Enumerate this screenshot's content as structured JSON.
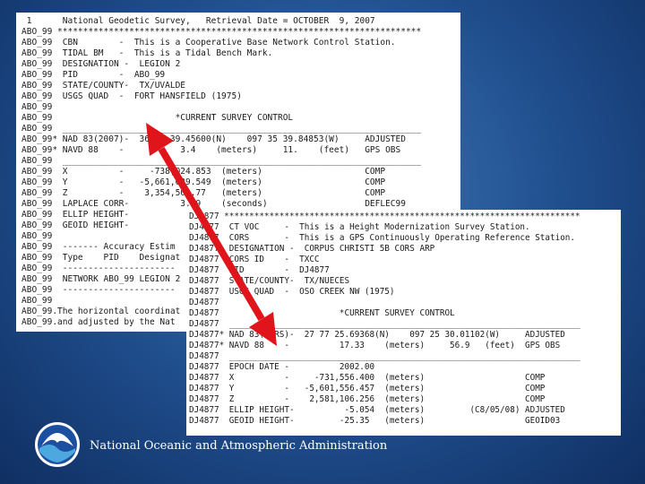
{
  "colors": {
    "background": "#2a5b9c",
    "arrow": "#e0141b",
    "sheet": "#ffffff"
  },
  "sheet1_lines": [
    " 1      National Geodetic Survey,   Retrieval Date = OCTOBER  9, 2007",
    "ABO_99 ***********************************************************************",
    "ABO_99  CBN        -  This is a Cooperative Base Network Control Station.",
    "ABO_99  TIDAL BM   -  This is a Tidal Bench Mark.",
    "ABO_99  DESIGNATION -  LEGION 2",
    "ABO_99  PID        -  ABO_99",
    "ABO_99  STATE/COUNTY-  TX/UVALDE",
    "ABO_99  USGS QUAD  -  FORT HANSFIELD (1975)",
    "ABO_99",
    "ABO_99                        *CURRENT SURVEY CONTROL",
    "ABO_99  ______________________________________________________________________",
    "ABO_99* NAD 83(2007)-  36 33 39.45600(N)    097 35 39.84853(W)     ADJUSTED",
    "ABO_99* NAVD 88    -           3.4    (meters)     11.    (feet)   GPS OBS",
    "ABO_99  ______________________________________________________________________",
    "ABO_99  X          -     -738,024.853  (meters)                    COMP",
    "ABO_99  Y          -   -5,661,089.549  (meters)                    COMP",
    "ABO_99  Z          -    3,354,503.77   (meters)                    COMP",
    "ABO_99  LAPLACE CORR-          3.09    (seconds)                   DEFLEC99",
    "ABO_99  ELLIP HEIGHT-",
    "ABO_99  GEOID HEIGHT-",
    "ABO_99",
    "ABO_99  ------- Accuracy Estim",
    "ABO_99  Type    PID    Designat",
    "ABO_99  ----------------------",
    "ABO_99  NETWORK ABO_99 LEGION 2",
    "ABO_99  ----------------------",
    "ABO_99",
    "ABO_99.The horizontal coordinat",
    "ABO_99.and adjusted by the Nat"
  ],
  "sheet2_lines": [
    "DJ4877 ***********************************************************************",
    "DJ4877  CT VOC     -  This is a Height Modernization Survey Station.",
    "DJ4877  CORS       -  This is a GPS Continuously Operating Reference Station.",
    "DJ4877  DESIGNATION -  CORPUS CHRISTI 5B CORS ARP",
    "DJ4877  CORS ID    -  TXCC",
    "DJ4877  PID        -  DJ4877",
    "DJ4877  STATE/COUNTY-  TX/NUECES",
    "DJ4877  USGS QUAD  -  OSO CREEK NW (1975)",
    "DJ4877",
    "DJ4877                        *CURRENT SURVEY CONTROL",
    "DJ4877  ______________________________________________________________________",
    "DJ4877* NAD 83(CORS)-  27 77 25.69368(N)    097 25 30.01102(W)     ADJUSTED",
    "DJ4877* NAVD 88    -          17.33    (meters)     56.9   (feet)  GPS OBS",
    "DJ4877  ______________________________________________________________________",
    "DJ4877  EPOCH DATE -          2002.00",
    "DJ4877  X          -     -731,556.400  (meters)                    COMP",
    "DJ4877  Y          -   -5,601,556.457  (meters)                    COMP",
    "DJ4877  Z          -    2,581,106.256  (meters)                    COMP",
    "DJ4877  ELLIP HEIGHT-          -5.054  (meters)         (C8/05/08) ADJUSTED",
    "DJ4877  GEOID HEIGHT-         -25.35   (meters)                    GEOID03"
  ],
  "agency_name": "National Oceanic and Atmospheric Administration",
  "logo_text": "NOAA"
}
